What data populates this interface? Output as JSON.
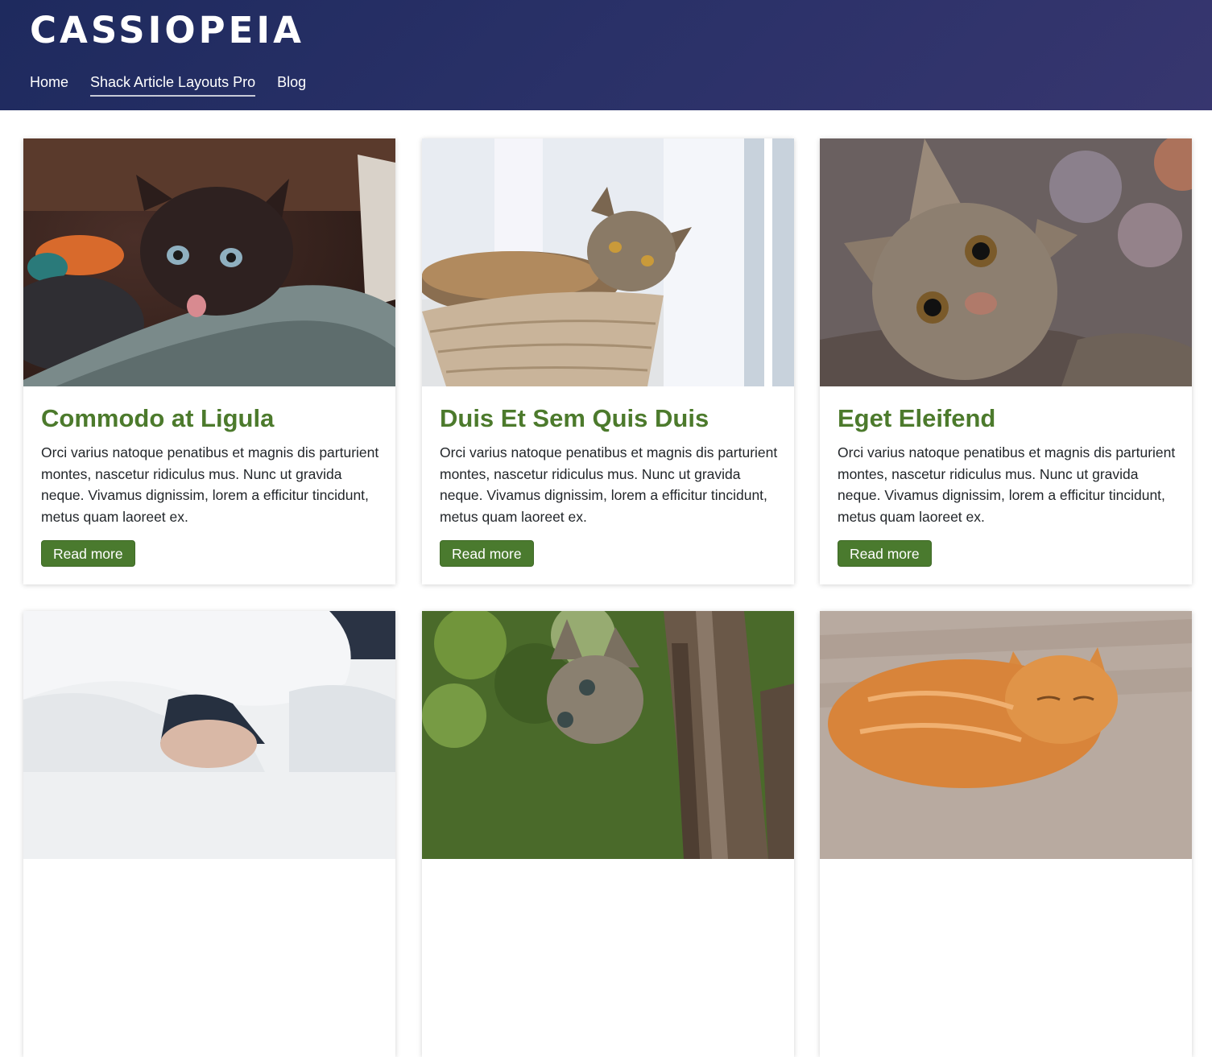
{
  "site": {
    "brand": "CASSIOPEIA"
  },
  "nav": {
    "items": [
      {
        "label": "Home",
        "active": false
      },
      {
        "label": "Shack Article Layouts Pro",
        "active": true
      },
      {
        "label": "Blog",
        "active": false
      }
    ]
  },
  "articles": [
    {
      "title": "Commodo at Ligula",
      "excerpt": "Orci varius natoque penatibus et magnis dis parturient montes, nascetur ridiculus mus. Nunc ut gravida neque. Vivamus dignissim, lorem a efficitur tincidunt, metus quam laoreet ex.",
      "button": "Read more",
      "image": "dark kitten on grey blanket"
    },
    {
      "title": "Duis Et Sem Quis Duis",
      "excerpt": "Orci varius natoque penatibus et magnis dis parturient montes, nascetur ridiculus mus. Nunc ut gravida neque. Vivamus dignissim, lorem a efficitur tincidunt, metus quam laoreet ex.",
      "button": "Read more",
      "image": "tabby cat in woven basket by window"
    },
    {
      "title": "Eget Eleifend",
      "excerpt": "Orci varius natoque penatibus et magnis dis parturient montes, nascetur ridiculus mus. Nunc ut gravida neque. Vivamus dignissim, lorem a efficitur tincidunt, metus quam laoreet ex.",
      "button": "Read more",
      "image": "close-up tabby cat looking up"
    },
    {
      "title": "",
      "excerpt": "",
      "button": "",
      "image": "kitten under white bedsheet"
    },
    {
      "title": "",
      "excerpt": "",
      "button": "",
      "image": "tabby kitten by tree trunk"
    },
    {
      "title": "",
      "excerpt": "",
      "button": "",
      "image": "orange cat sleeping on wooden floor"
    }
  ],
  "colors": {
    "header_gradient_start": "#1e2a5e",
    "header_gradient_end": "#37366f",
    "title_green": "#4c7a2c",
    "button_green": "#4a7a2e"
  }
}
